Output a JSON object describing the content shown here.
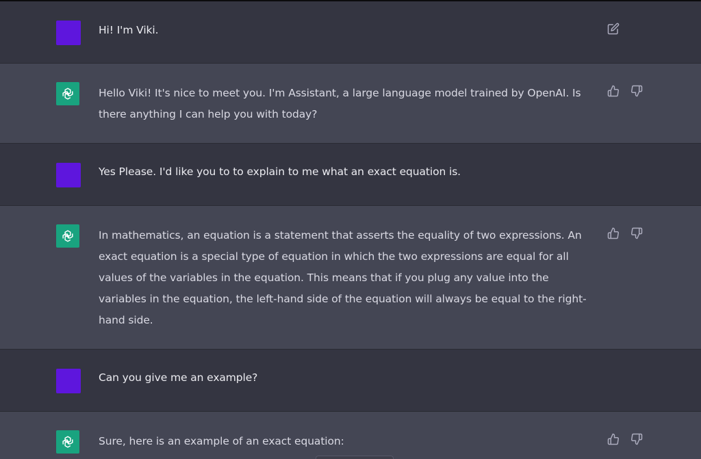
{
  "conversation": {
    "messages": [
      {
        "role": "user",
        "text": "Hi! I'm Viki."
      },
      {
        "role": "assistant",
        "text": "Hello Viki! It's nice to meet you. I'm Assistant, a large language model trained by OpenAI. Is there anything I can help you with today?"
      },
      {
        "role": "user",
        "text": "Yes Please. I'd like you to to explain to me what an exact equation is."
      },
      {
        "role": "assistant",
        "text": "In mathematics, an equation is a statement that asserts the equality of two expressions. An exact equation is a special type of equation in which the two expressions are equal for all values of the variables in the equation. This means that if you plug any value into the variables in the equation, the left-hand side of the equation will always be equal to the right-hand side."
      },
      {
        "role": "user",
        "text": "Can you give me an example?"
      },
      {
        "role": "assistant",
        "text": "Sure, here is an example of an exact equation:"
      }
    ]
  },
  "icons": {
    "edit": "edit-icon",
    "thumbs_up": "thumbs-up-icon",
    "thumbs_down": "thumbs-down-icon",
    "assistant_logo": "openai-logo-icon"
  },
  "colors": {
    "user_row_bg": "#343541",
    "assistant_row_bg": "#444654",
    "user_avatar": "#5e16dd",
    "assistant_avatar": "#19a37f",
    "text": "#ececf1"
  }
}
